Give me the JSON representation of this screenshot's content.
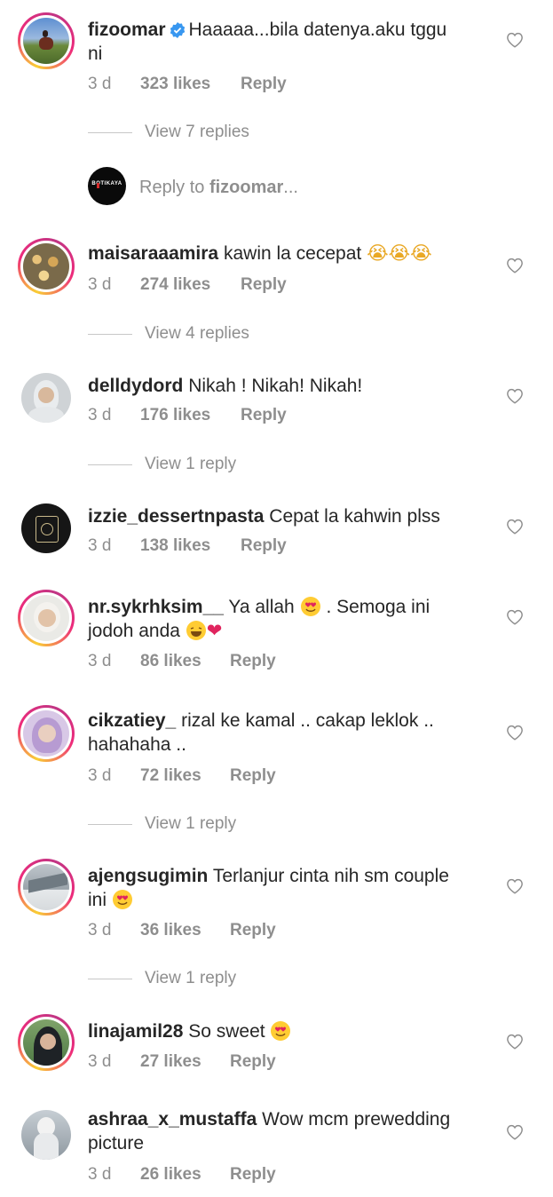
{
  "colors": {
    "text": "#262626",
    "muted": "#8e8e8e",
    "verified": "#3897f0",
    "heart_red": "#e0245e"
  },
  "comments": [
    {
      "user": "fizoomar",
      "verified": true,
      "text_line1": "Haaaaa...bila datenya.aku tggu",
      "text_line2": "ni",
      "time": "3 d",
      "likes": "323 likes",
      "reply": "Reply",
      "view_replies": "View 7 replies"
    },
    {
      "user": "maisaraaamira",
      "text_line1": "kawin la cecepat",
      "emoji": "😭😭😭",
      "time": "3 d",
      "likes": "274 likes",
      "reply": "Reply",
      "view_replies": "View 4 replies"
    },
    {
      "user": "delldydord",
      "text_line1": "Nikah ! Nikah!  Nikah!",
      "time": "3 d",
      "likes": "176 likes",
      "reply": "Reply",
      "view_replies": "View 1 reply"
    },
    {
      "user": "izzie_dessertnpasta",
      "text_line1": "Cepat la kahwin plss",
      "time": "3 d",
      "likes": "138 likes",
      "reply": "Reply"
    },
    {
      "user": "nr.sykrhksim__",
      "text_line1a": "Ya allah",
      "text_line1b": ". Semoga ini",
      "text_line2": "jodoh anda",
      "time": "3 d",
      "likes": "86 likes",
      "reply": "Reply"
    },
    {
      "user": "cikzatiey_",
      "text_line1": "rizal ke kamal .. cakap leklok ..",
      "text_line2": "hahahaha ..",
      "time": "3 d",
      "likes": "72 likes",
      "reply": "Reply",
      "view_replies": "View 1 reply"
    },
    {
      "user": "ajengsugimin",
      "text_line1": "Terlanjur cinta nih sm couple",
      "text_line2": "ini",
      "time": "3 d",
      "likes": "36 likes",
      "reply": "Reply",
      "view_replies": "View 1 reply"
    },
    {
      "user": "linajamil28",
      "text_line1": "So sweet",
      "time": "3 d",
      "likes": "27 likes",
      "reply": "Reply"
    },
    {
      "user": "ashraa_x_mustaffa",
      "text_line1": "Wow mcm prewedding",
      "text_line2": "picture",
      "time": "3 d",
      "likes": "26 likes",
      "reply": "Reply"
    }
  ],
  "reply_box": {
    "placeholder_prefix": "Reply to ",
    "placeholder_user": "fizoomar",
    "placeholder_suffix": "...",
    "logo_text": "BOTIKAYA"
  }
}
